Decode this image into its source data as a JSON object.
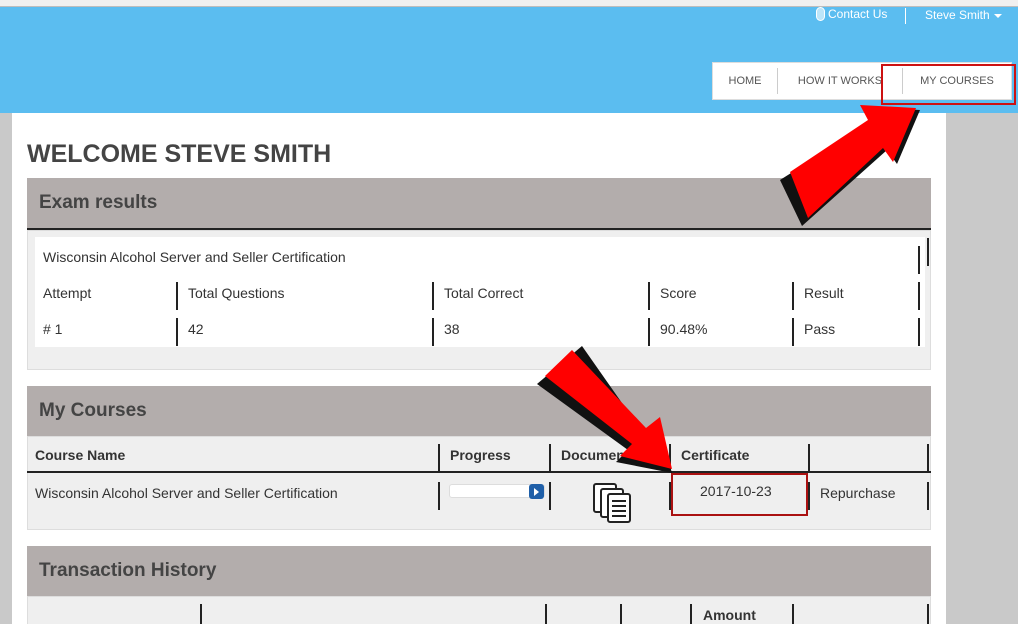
{
  "header": {
    "contact_label": "Contact Us",
    "user_name": "Steve Smith",
    "nav": [
      "HOME",
      "HOW IT WORKS",
      "MY COURSES"
    ],
    "colors": {
      "header_bg": "#5bbdf0",
      "highlight": "#cc1111"
    }
  },
  "welcome": "WELCOME STEVE SMITH",
  "exam": {
    "title": "Exam results",
    "course": "Wisconsin Alcohol Server and Seller Certification",
    "headers": [
      "Attempt",
      "Total Questions",
      "Total Correct",
      "Score",
      "Result"
    ],
    "row": [
      "# 1",
      "42",
      "38",
      "90.48%",
      "Pass"
    ]
  },
  "courses": {
    "title": "My Courses",
    "headers": [
      "Course Name",
      "Progress",
      "Documents",
      "Certificate"
    ],
    "row": {
      "name": "Wisconsin Alcohol Server and Seller Certification",
      "certificate": "2017-10-23",
      "action": "Repurchase"
    }
  },
  "transactions": {
    "title": "Transaction History",
    "headers": [
      "Amount"
    ]
  }
}
